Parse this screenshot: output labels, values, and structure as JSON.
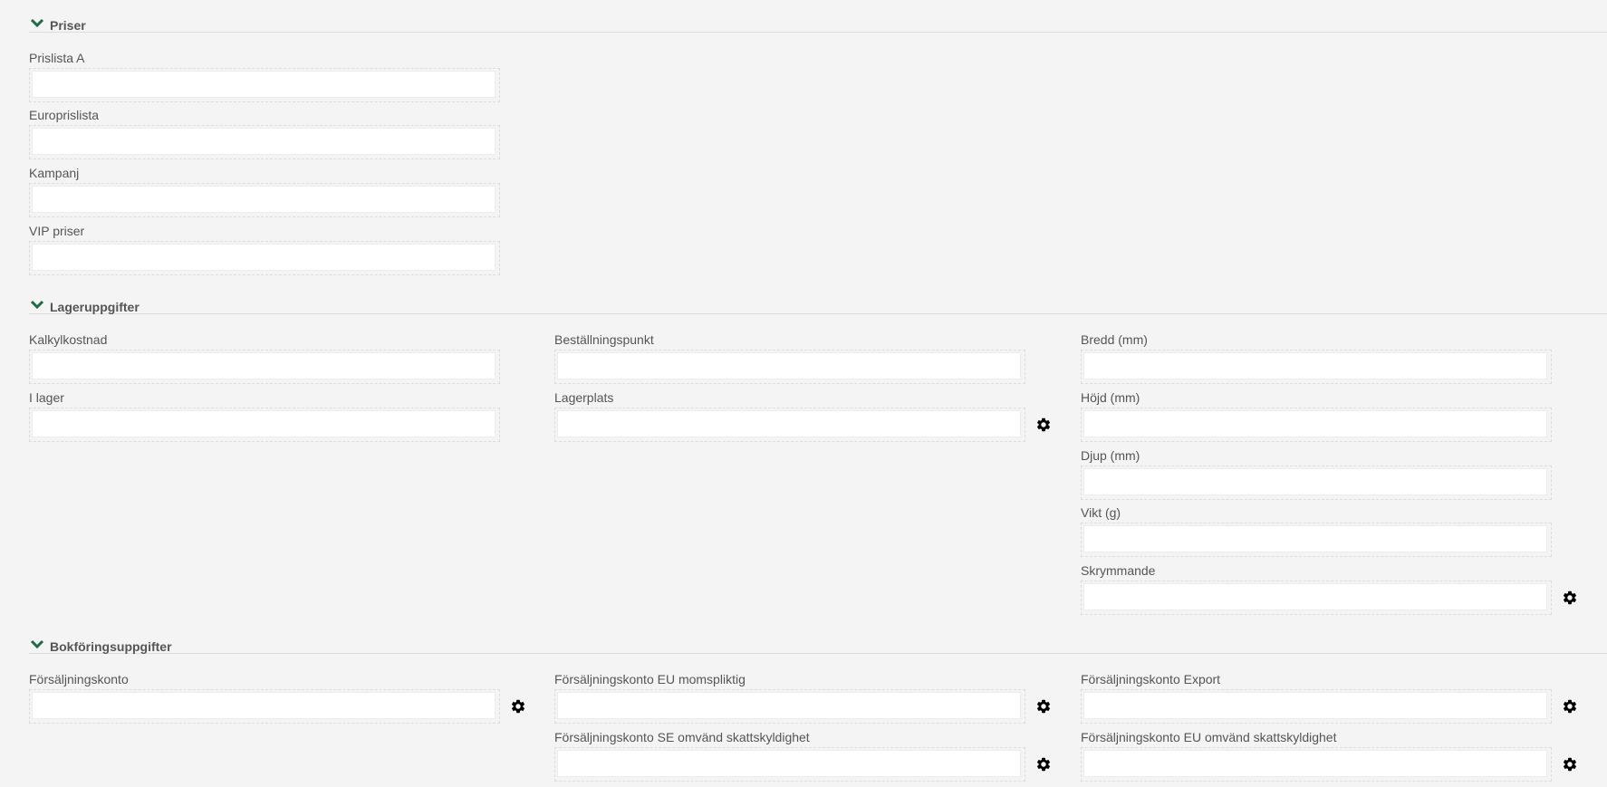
{
  "sections": {
    "priser": {
      "title": "Priser"
    },
    "lager": {
      "title": "Lageruppgifter"
    },
    "bokforing": {
      "title": "Bokföringsuppgifter"
    }
  },
  "fields": {
    "prislista_a": {
      "label": "Prislista A",
      "value": ""
    },
    "europrislista": {
      "label": "Europrislista",
      "value": ""
    },
    "kampanj": {
      "label": "Kampanj",
      "value": ""
    },
    "vip_priser": {
      "label": "VIP priser",
      "value": ""
    },
    "kalkylkostnad": {
      "label": "Kalkylkostnad",
      "value": ""
    },
    "i_lager": {
      "label": "I lager",
      "value": ""
    },
    "bestallningspunkt": {
      "label": "Beställningspunkt",
      "value": ""
    },
    "lagerplats": {
      "label": "Lagerplats",
      "value": ""
    },
    "bredd": {
      "label": "Bredd (mm)",
      "value": ""
    },
    "hojd": {
      "label": "Höjd (mm)",
      "value": ""
    },
    "djup": {
      "label": "Djup (mm)",
      "value": ""
    },
    "vikt": {
      "label": "Vikt (g)",
      "value": ""
    },
    "skrymmande": {
      "label": "Skrymmande",
      "value": ""
    },
    "forsaljningskonto": {
      "label": "Försäljningskonto",
      "value": ""
    },
    "fk_eu_momspliktig": {
      "label": "Försäljningskonto EU momspliktig",
      "value": ""
    },
    "fk_export": {
      "label": "Försäljningskonto Export",
      "value": ""
    },
    "fk_se_omvand": {
      "label": "Försäljningskonto SE omvänd skattskyldighet",
      "value": ""
    },
    "fk_eu_omvand": {
      "label": "Försäljningskonto EU omvänd skattskyldighet",
      "value": ""
    }
  },
  "icons": {
    "section_toggle": "chevron-down-icon",
    "settings": "gear-icon"
  },
  "colors": {
    "accent": "#1e6b45",
    "background": "#f4f4f4",
    "gear": "#000000"
  }
}
